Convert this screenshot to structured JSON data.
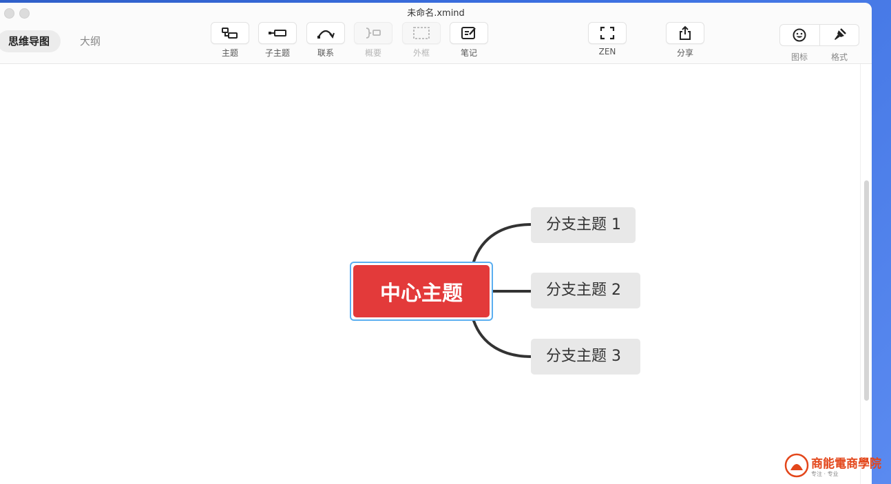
{
  "window": {
    "title": "未命名.xmind"
  },
  "view_tabs": [
    {
      "label": "思维导图",
      "active": true
    },
    {
      "label": "大纲",
      "active": false
    }
  ],
  "toolbar": {
    "topic": "主题",
    "subtopic": "子主题",
    "relationship": "联系",
    "summary": "概要",
    "boundary": "外框",
    "notes": "笔记",
    "zen": "ZEN",
    "share": "分享",
    "icon": "图标",
    "format": "格式"
  },
  "mindmap": {
    "central": "中心主题",
    "branches": [
      "分支主题 1",
      "分支主题 2",
      "分支主题 3"
    ],
    "colors": {
      "central_fill": "#e33a3a",
      "selection": "#5aaef0",
      "branch_fill": "#e8e8e8",
      "connector": "#333333"
    }
  },
  "watermark": {
    "text": "商能電商學院",
    "sub": "专注 · 专业"
  }
}
